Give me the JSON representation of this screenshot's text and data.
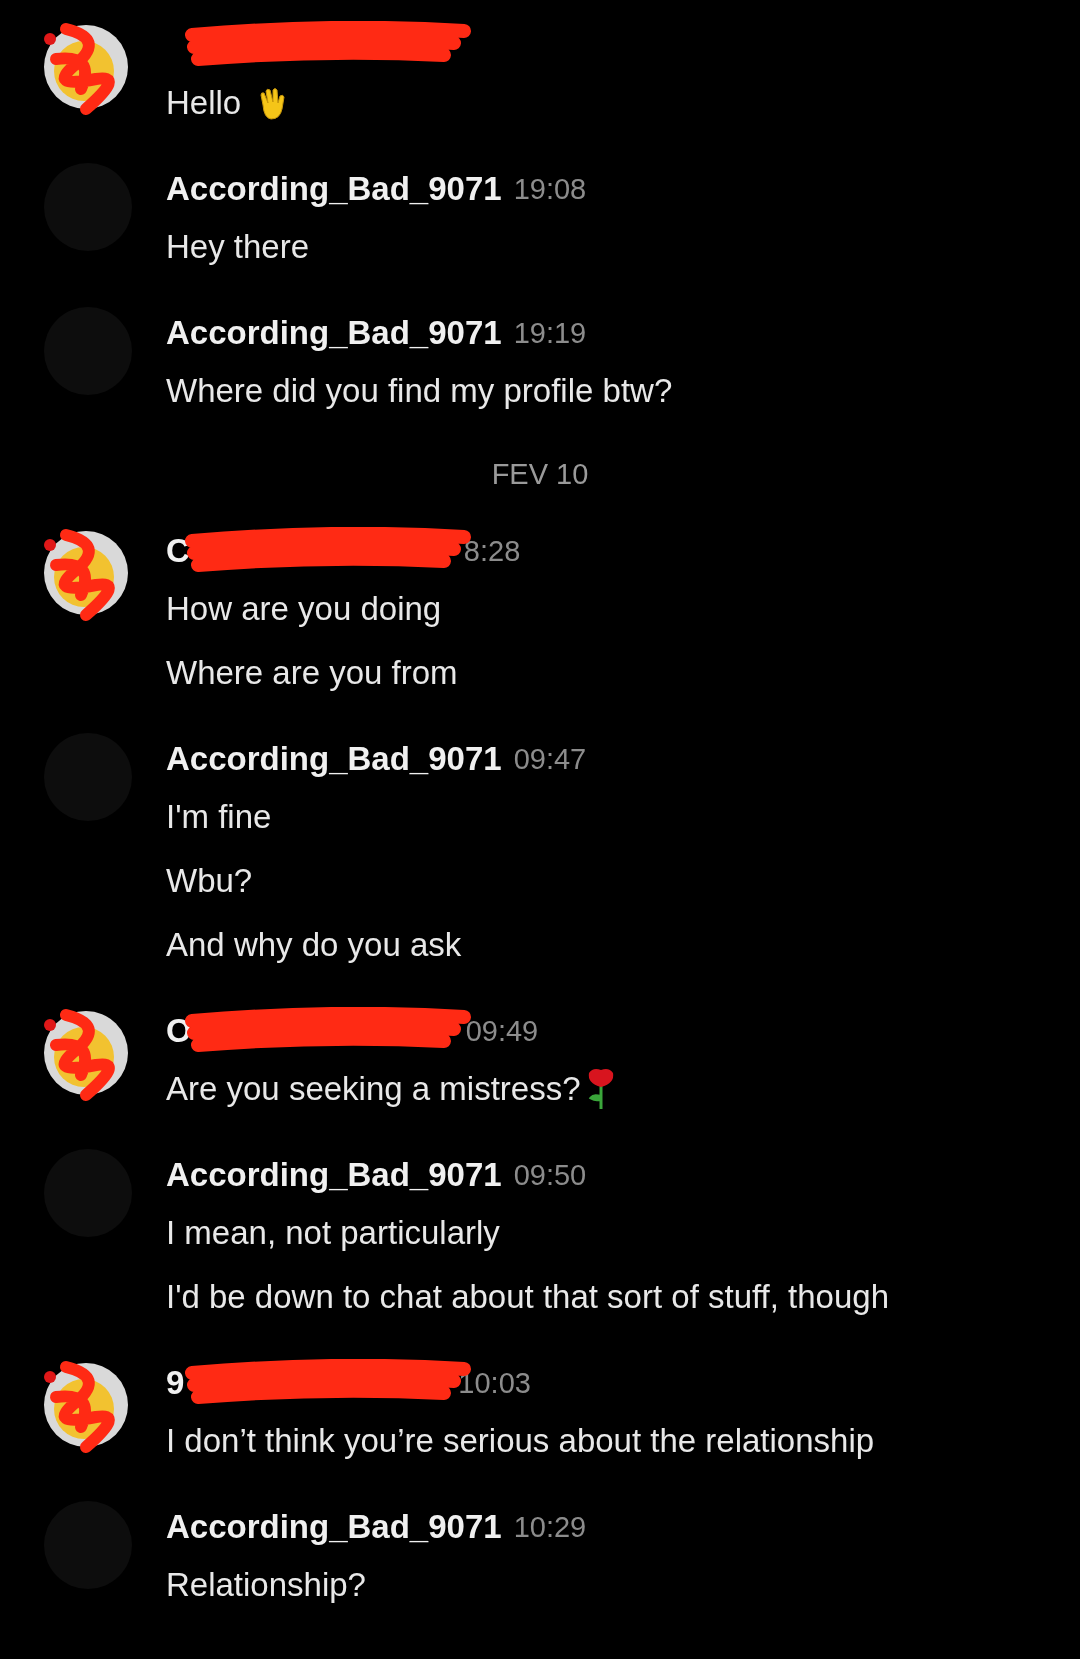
{
  "feed": [
    {
      "kind": "message",
      "avatar": {
        "kind": "redacted"
      },
      "lines": [
        {
          "text": "Hello",
          "emoji": {
            "kind": "wave"
          }
        }
      ]
    },
    {
      "kind": "message",
      "avatar": {
        "kind": "plain"
      },
      "name": "According_Bad_9071",
      "time": "19:08",
      "lines": [
        {
          "text": "Hey there"
        }
      ]
    },
    {
      "kind": "message",
      "avatar": {
        "kind": "plain"
      },
      "name": "According_Bad_9071",
      "time": "19:19",
      "lines": [
        {
          "text": "Where did you find my profile btw?"
        }
      ]
    },
    {
      "kind": "date",
      "text": "FEV 10"
    },
    {
      "kind": "message",
      "avatar": {
        "kind": "redacted"
      },
      "name": "C",
      "time": "8:28",
      "lines": [
        {
          "text": "How are you doing"
        },
        {
          "text": "Where are you from"
        }
      ]
    },
    {
      "kind": "message",
      "avatar": {
        "kind": "plain"
      },
      "name": "According_Bad_9071",
      "time": "09:47",
      "lines": [
        {
          "text": "I'm fine"
        },
        {
          "text": "Wbu?"
        },
        {
          "text": "And why do you ask"
        }
      ]
    },
    {
      "kind": "message",
      "avatar": {
        "kind": "redacted"
      },
      "name": "O",
      "time": "09:49",
      "lines": [
        {
          "text": "Are you seeking a mistress?",
          "emoji": {
            "kind": "rose"
          }
        }
      ]
    },
    {
      "kind": "message",
      "avatar": {
        "kind": "plain"
      },
      "name": "According_Bad_9071",
      "time": "09:50",
      "lines": [
        {
          "text": "I mean, not particularly"
        },
        {
          "text": "I'd be down to chat about that sort of stuff, though"
        }
      ]
    },
    {
      "kind": "message",
      "avatar": {
        "kind": "redacted"
      },
      "name": "9",
      "time": "10:03",
      "lines": [
        {
          "text": "I don’t think you’re serious about the relationship"
        }
      ]
    },
    {
      "kind": "message",
      "avatar": {
        "kind": "plain"
      },
      "name": "According_Bad_9071",
      "time": "10:29",
      "lines": [
        {
          "text": "Relationship?"
        }
      ]
    }
  ]
}
